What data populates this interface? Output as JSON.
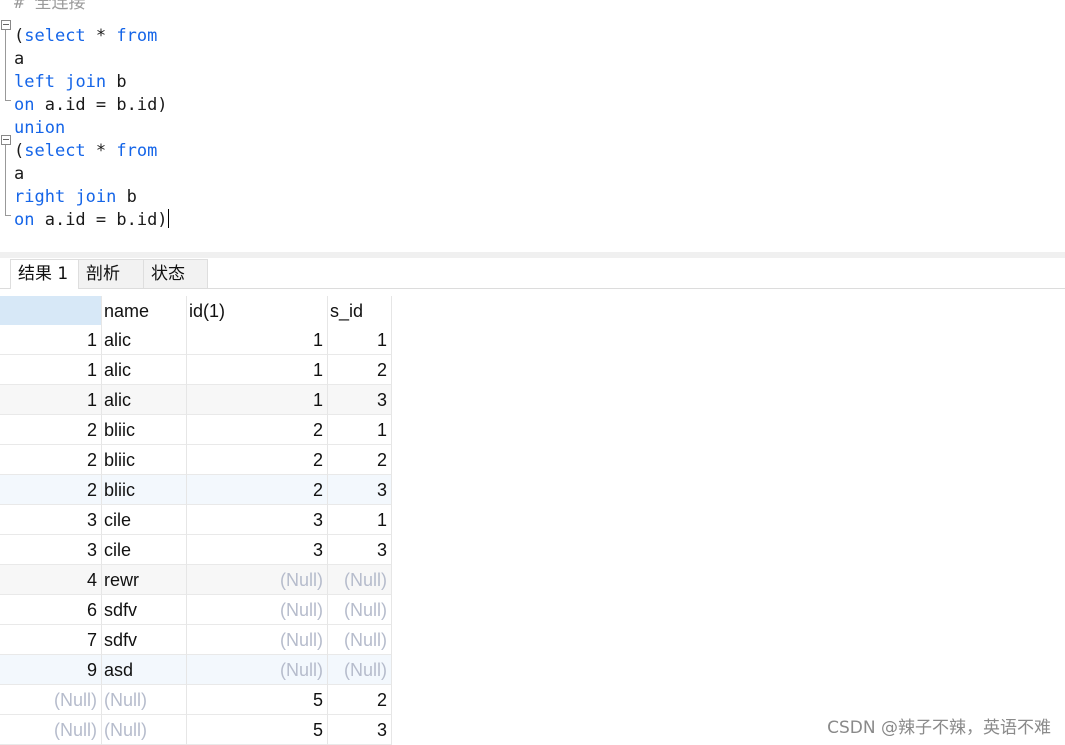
{
  "editor": {
    "lines": [
      [
        [
          "# 全连接",
          "cm"
        ]
      ],
      [
        [
          "(",
          ""
        ],
        [
          "select",
          "kw"
        ],
        [
          " * ",
          ""
        ],
        [
          "from",
          "kw"
        ]
      ],
      [
        [
          "a",
          ""
        ]
      ],
      [
        [
          "left",
          "kw"
        ],
        [
          " ",
          ""
        ],
        [
          "join",
          "kw"
        ],
        [
          " b",
          ""
        ]
      ],
      [
        [
          "on",
          "kw"
        ],
        [
          " a.id = b.id)",
          ""
        ]
      ],
      [
        [
          "union",
          "kw"
        ]
      ],
      [
        [
          "(",
          ""
        ],
        [
          "select",
          "kw"
        ],
        [
          " * ",
          ""
        ],
        [
          "from",
          "kw"
        ]
      ],
      [
        [
          "a",
          ""
        ]
      ],
      [
        [
          "right",
          "kw"
        ],
        [
          " ",
          ""
        ],
        [
          "join",
          "kw"
        ],
        [
          " b",
          ""
        ]
      ],
      [
        [
          "on",
          "kw"
        ],
        [
          " a.id = b.id)",
          ""
        ]
      ]
    ],
    "keyword_color": "#1565e8"
  },
  "tabs": [
    {
      "label": "结果 1",
      "active": true
    },
    {
      "label": "剖析",
      "active": false
    },
    {
      "label": "状态",
      "active": false
    }
  ],
  "result": {
    "columns": [
      "",
      "name",
      "id(1)",
      "s_id"
    ],
    "rows": [
      [
        "1",
        "alic",
        "1",
        "1"
      ],
      [
        "1",
        "alic",
        "1",
        "2"
      ],
      [
        "1",
        "alic",
        "1",
        "3"
      ],
      [
        "2",
        "bliic",
        "2",
        "1"
      ],
      [
        "2",
        "bliic",
        "2",
        "2"
      ],
      [
        "2",
        "bliic",
        "2",
        "3"
      ],
      [
        "3",
        "cile",
        "3",
        "1"
      ],
      [
        "3",
        "cile",
        "3",
        "3"
      ],
      [
        "4",
        "rewr",
        "(Null)",
        "(Null)"
      ],
      [
        "6",
        "sdfv",
        "(Null)",
        "(Null)"
      ],
      [
        "7",
        "sdfv",
        "(Null)",
        "(Null)"
      ],
      [
        "9",
        "asd",
        "(Null)",
        "(Null)"
      ],
      [
        "(Null)",
        "(Null)",
        "5",
        "2"
      ],
      [
        "(Null)",
        "(Null)",
        "5",
        "3"
      ]
    ],
    "row_colors": [
      "#ffffff",
      "#ffffff",
      "#f7f7f7",
      "#ffffff",
      "#ffffff",
      "#f3f8fd",
      "#ffffff",
      "#ffffff",
      "#f7f7f7",
      "#ffffff",
      "#ffffff",
      "#f3f8fd",
      "#ffffff",
      "#ffffff"
    ],
    "null_color": "#b6bccc"
  },
  "watermark": "CSDN @辣子不辣，英语不难"
}
